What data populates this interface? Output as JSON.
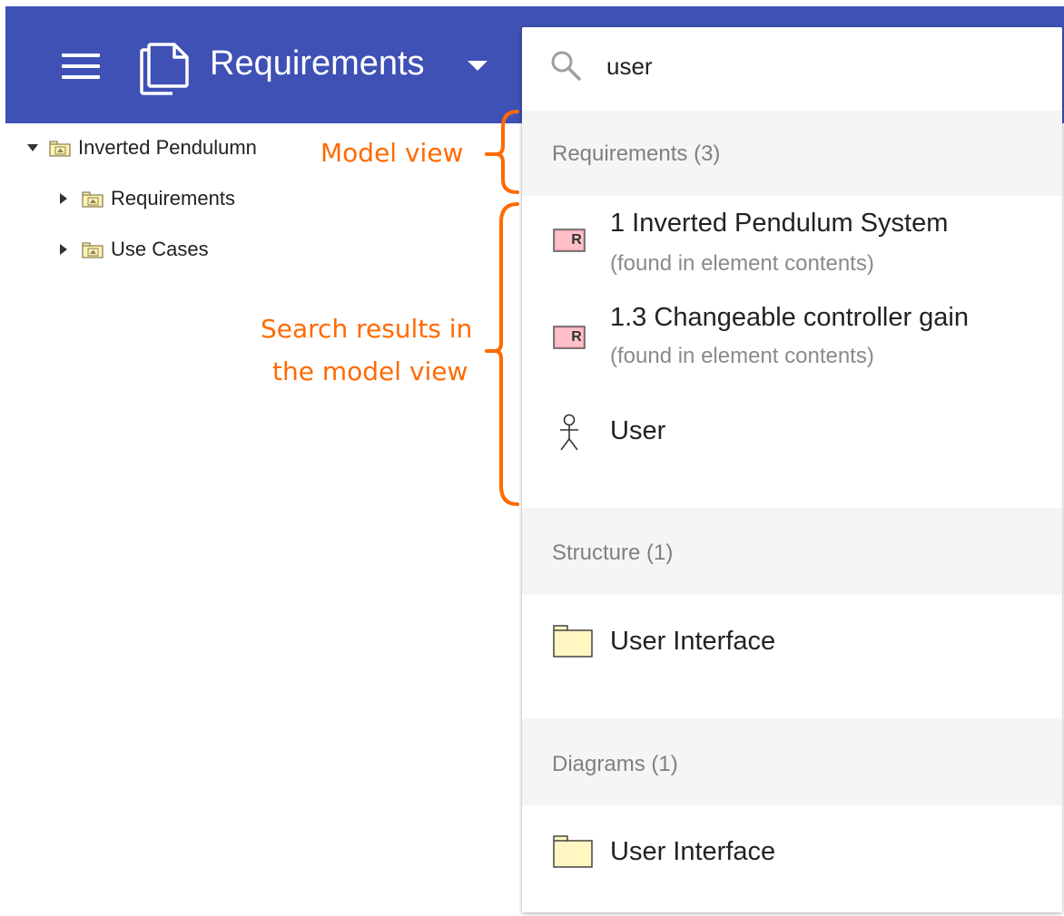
{
  "header": {
    "menu_icon": "hamburger-menu-icon",
    "app_icon": "document-copy-icon",
    "title": "Requirements",
    "dropdown_icon": "caret-down-icon",
    "bar_color": "#3f51b5"
  },
  "tree": {
    "root": {
      "label": "Inverted Pendulumn",
      "expanded": true,
      "icon": "package-icon"
    },
    "children": [
      {
        "label": "Requirements",
        "expanded": false,
        "icon": "package-icon"
      },
      {
        "label": "Use Cases",
        "expanded": false,
        "icon": "package-icon"
      }
    ]
  },
  "annotations": {
    "model_view": "Model view",
    "search_results_line1": "Search results in",
    "search_results_line2": "the model view",
    "color": "#ff6a00"
  },
  "search": {
    "icon": "search-icon",
    "query": "user",
    "sections": [
      {
        "title": "Requirements (3)",
        "results": [
          {
            "icon": "requirement-icon",
            "badge": "R",
            "title": "1 Inverted Pendulum System",
            "subtitle": "(found in element contents)"
          },
          {
            "icon": "requirement-icon",
            "badge": "R",
            "title": "1.3 Changeable controller gain",
            "subtitle": "(found in element contents)"
          },
          {
            "icon": "actor-icon",
            "title": "User"
          }
        ]
      },
      {
        "title": "Structure (1)",
        "results": [
          {
            "icon": "folder-icon",
            "title": "User Interface"
          }
        ]
      },
      {
        "title": "Diagrams (1)",
        "results": [
          {
            "icon": "folder-icon",
            "title": "User Interface"
          }
        ]
      }
    ]
  }
}
